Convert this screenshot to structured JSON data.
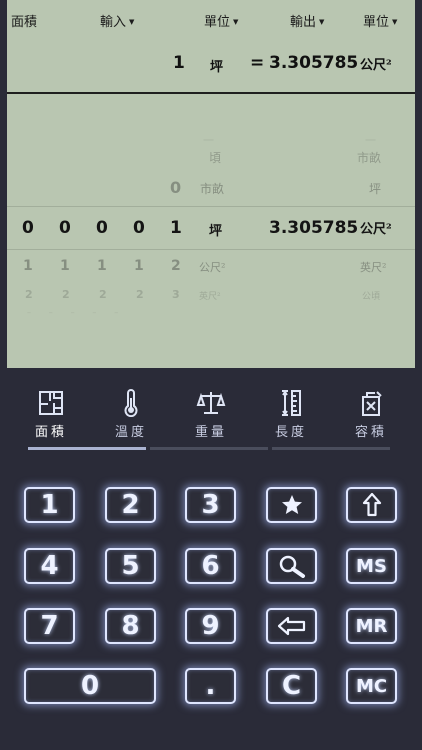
{
  "header": {
    "area_label": "面積",
    "input_label": "輸入",
    "unit_label_left": "單位",
    "output_label": "輸出",
    "unit_label_right": "單位"
  },
  "main": {
    "input_value": "1",
    "input_unit": "坪",
    "equals": "=",
    "output_value": "3.305785",
    "output_unit": "公尺²"
  },
  "list": {
    "row_a": {
      "left_unit": "頃",
      "right_unit": "市畝"
    },
    "row_b": {
      "value": "0",
      "left_unit": "市畝",
      "right_unit": "坪"
    },
    "row_current": {
      "digits": [
        "0",
        "0",
        "0",
        "0",
        "1"
      ],
      "left_unit": "坪",
      "value": "3.305785",
      "right_unit": "公尺²"
    },
    "row_c": {
      "digits": [
        "1",
        "1",
        "1",
        "1",
        "2"
      ],
      "left_unit": "公尺²",
      "right_unit": "英尺²"
    },
    "row_d": {
      "digits": [
        "2",
        "2",
        "2",
        "2",
        "3"
      ],
      "left_unit": "英尺²",
      "right_unit": "公頃"
    }
  },
  "tabs": [
    {
      "label": "面積",
      "icon": "floorplan-icon",
      "active": true
    },
    {
      "label": "溫度",
      "icon": "thermometer-icon",
      "active": false
    },
    {
      "label": "重量",
      "icon": "scale-icon",
      "active": false
    },
    {
      "label": "長度",
      "icon": "ruler-icon",
      "active": false
    },
    {
      "label": "容積",
      "icon": "jerrycan-icon",
      "active": false
    }
  ],
  "keys": {
    "k1": "1",
    "k2": "2",
    "k3": "3",
    "k4": "4",
    "k5": "5",
    "k6": "6",
    "k7": "7",
    "k8": "8",
    "k9": "9",
    "k0": "0",
    "dot": ".",
    "clear": "C",
    "ms": "MS",
    "mr": "MR",
    "mc": "MC",
    "favorite_icon": "star-icon",
    "shift_icon": "up-arrow-icon",
    "search_icon": "magnifier-icon",
    "backspace_icon": "backspace-icon"
  }
}
